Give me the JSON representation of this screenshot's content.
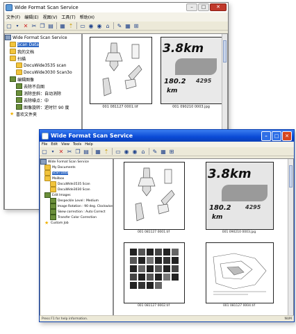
{
  "back_window": {
    "title": "Wide Format Scan Service",
    "menu": [
      "文件(F)",
      "编辑(E)",
      "视图(V)",
      "工具(T)",
      "帮助(H)"
    ],
    "tree": [
      {
        "label": "Wide Format Scan Service",
        "icon": "app-icon",
        "level": 0
      },
      {
        "label": "Scan Data",
        "icon": "folder-icon",
        "level": 1,
        "selected": true
      },
      {
        "label": "我的文档",
        "icon": "folder-icon",
        "level": 1
      },
      {
        "label": "扫描",
        "icon": "folder-icon",
        "level": 1
      },
      {
        "label": "DocuWide3535 scan",
        "icon": "folder-icon",
        "level": 2
      },
      {
        "label": "DocuWide3030 Scan3o",
        "icon": "folder-icon",
        "level": 2
      },
      {
        "label": "编辑图像",
        "icon": "edit-icon",
        "level": 1
      },
      {
        "label": "去除不白图",
        "icon": "edit-icon",
        "level": 2
      },
      {
        "label": "消除歪斜：自动消除",
        "icon": "edit-icon",
        "level": 2
      },
      {
        "label": "去除噪点：中",
        "icon": "edit-icon",
        "level": 2
      },
      {
        "label": "图像旋转：逆时针 90 度",
        "icon": "edit-icon",
        "level": 2
      },
      {
        "label": "喜欢文件夹",
        "icon": "star-icon",
        "level": 1
      }
    ],
    "thumbnails": [
      {
        "caption": "001 081127 0001.tif"
      },
      {
        "caption": "001 090210 0003.jpg"
      }
    ],
    "poster": {
      "big": "3.8km",
      "mid": "180.2",
      "unit": "km",
      "side": "4295"
    }
  },
  "front_window": {
    "title": "Wide Format Scan Service",
    "menu": [
      "File",
      "Edit",
      "View",
      "Tools",
      "Help"
    ],
    "tree": [
      {
        "label": "Wide Format Scan Service",
        "icon": "app-icon",
        "level": 0
      },
      {
        "label": "My Documents",
        "icon": "folder-icon",
        "level": 1
      },
      {
        "label": "Scan Data",
        "icon": "folder-icon",
        "level": 1,
        "selected": true
      },
      {
        "label": "Mailbox",
        "icon": "folder-icon",
        "level": 1
      },
      {
        "label": "DocuWide3535 Scan",
        "icon": "folder-icon",
        "level": 2
      },
      {
        "label": "DocuWide3030 Scan",
        "icon": "folder-icon",
        "level": 2
      },
      {
        "label": "Edit Images",
        "icon": "edit-icon",
        "level": 1
      },
      {
        "label": "Despeckle Level : Medium",
        "icon": "edit-icon",
        "level": 2
      },
      {
        "label": "Image Rotation : 90 deg. Clockwise",
        "icon": "edit-icon",
        "level": 2
      },
      {
        "label": "Skew correction : Auto Correct",
        "icon": "edit-icon",
        "level": 2
      },
      {
        "label": "Transfer Color Correction",
        "icon": "edit-icon",
        "level": 2
      },
      {
        "label": "Custom Job",
        "icon": "star-icon",
        "level": 1
      }
    ],
    "thumbnails": [
      {
        "caption": "001 081127 0001.tif"
      },
      {
        "caption": "001 090210 0003.jpg"
      },
      {
        "caption": "001 081127 0002.tif"
      },
      {
        "caption": "001 081127 0004.tif"
      }
    ],
    "poster": {
      "big": "3.8km",
      "mid": "180.2",
      "unit": "km",
      "side": "4295"
    },
    "status_left": "Press F1 for help information.",
    "status_right": "NUM"
  }
}
